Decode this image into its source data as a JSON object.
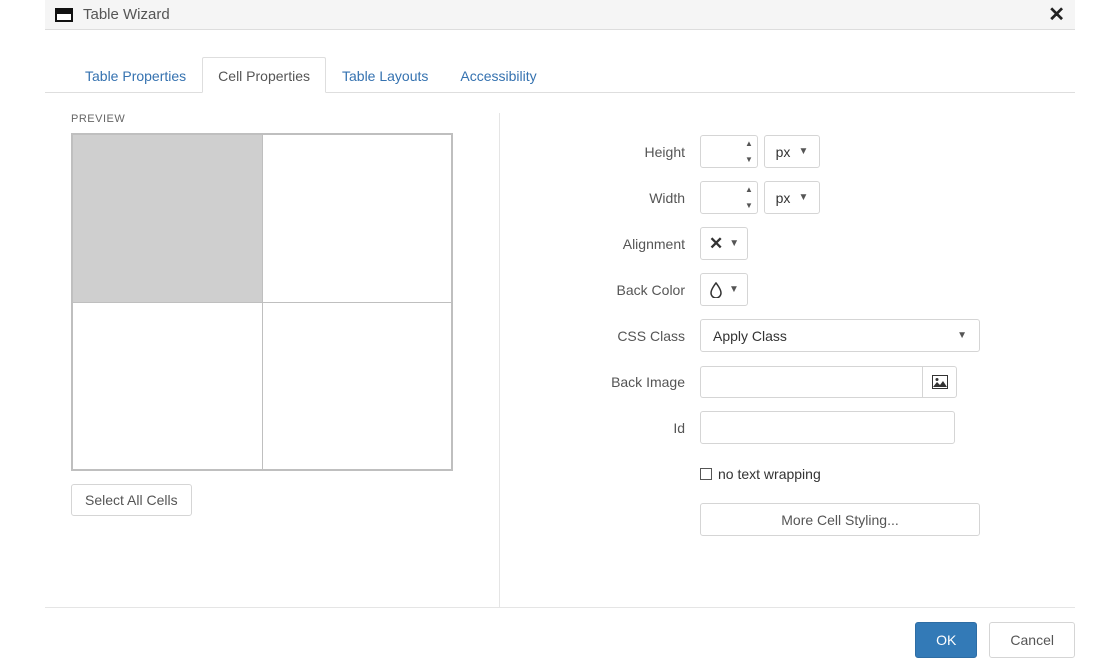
{
  "titlebar": {
    "title": "Table Wizard"
  },
  "tabs": [
    {
      "label": "Table Properties"
    },
    {
      "label": "Cell Properties"
    },
    {
      "label": "Table Layouts"
    },
    {
      "label": "Accessibility"
    }
  ],
  "active_tab_index": 1,
  "preview": {
    "label": "PREVIEW",
    "select_all_label": "Select All Cells"
  },
  "form": {
    "height_label": "Height",
    "height_value": "",
    "height_unit": "px",
    "width_label": "Width",
    "width_value": "",
    "width_unit": "px",
    "alignment_label": "Alignment",
    "backcolor_label": "Back Color",
    "cssclass_label": "CSS Class",
    "cssclass_value": "Apply Class",
    "backimage_label": "Back Image",
    "backimage_value": "",
    "id_label": "Id",
    "id_value": "",
    "nowrap_label": "no text wrapping",
    "morestyling_label": "More Cell Styling..."
  },
  "footer": {
    "ok": "OK",
    "cancel": "Cancel"
  }
}
